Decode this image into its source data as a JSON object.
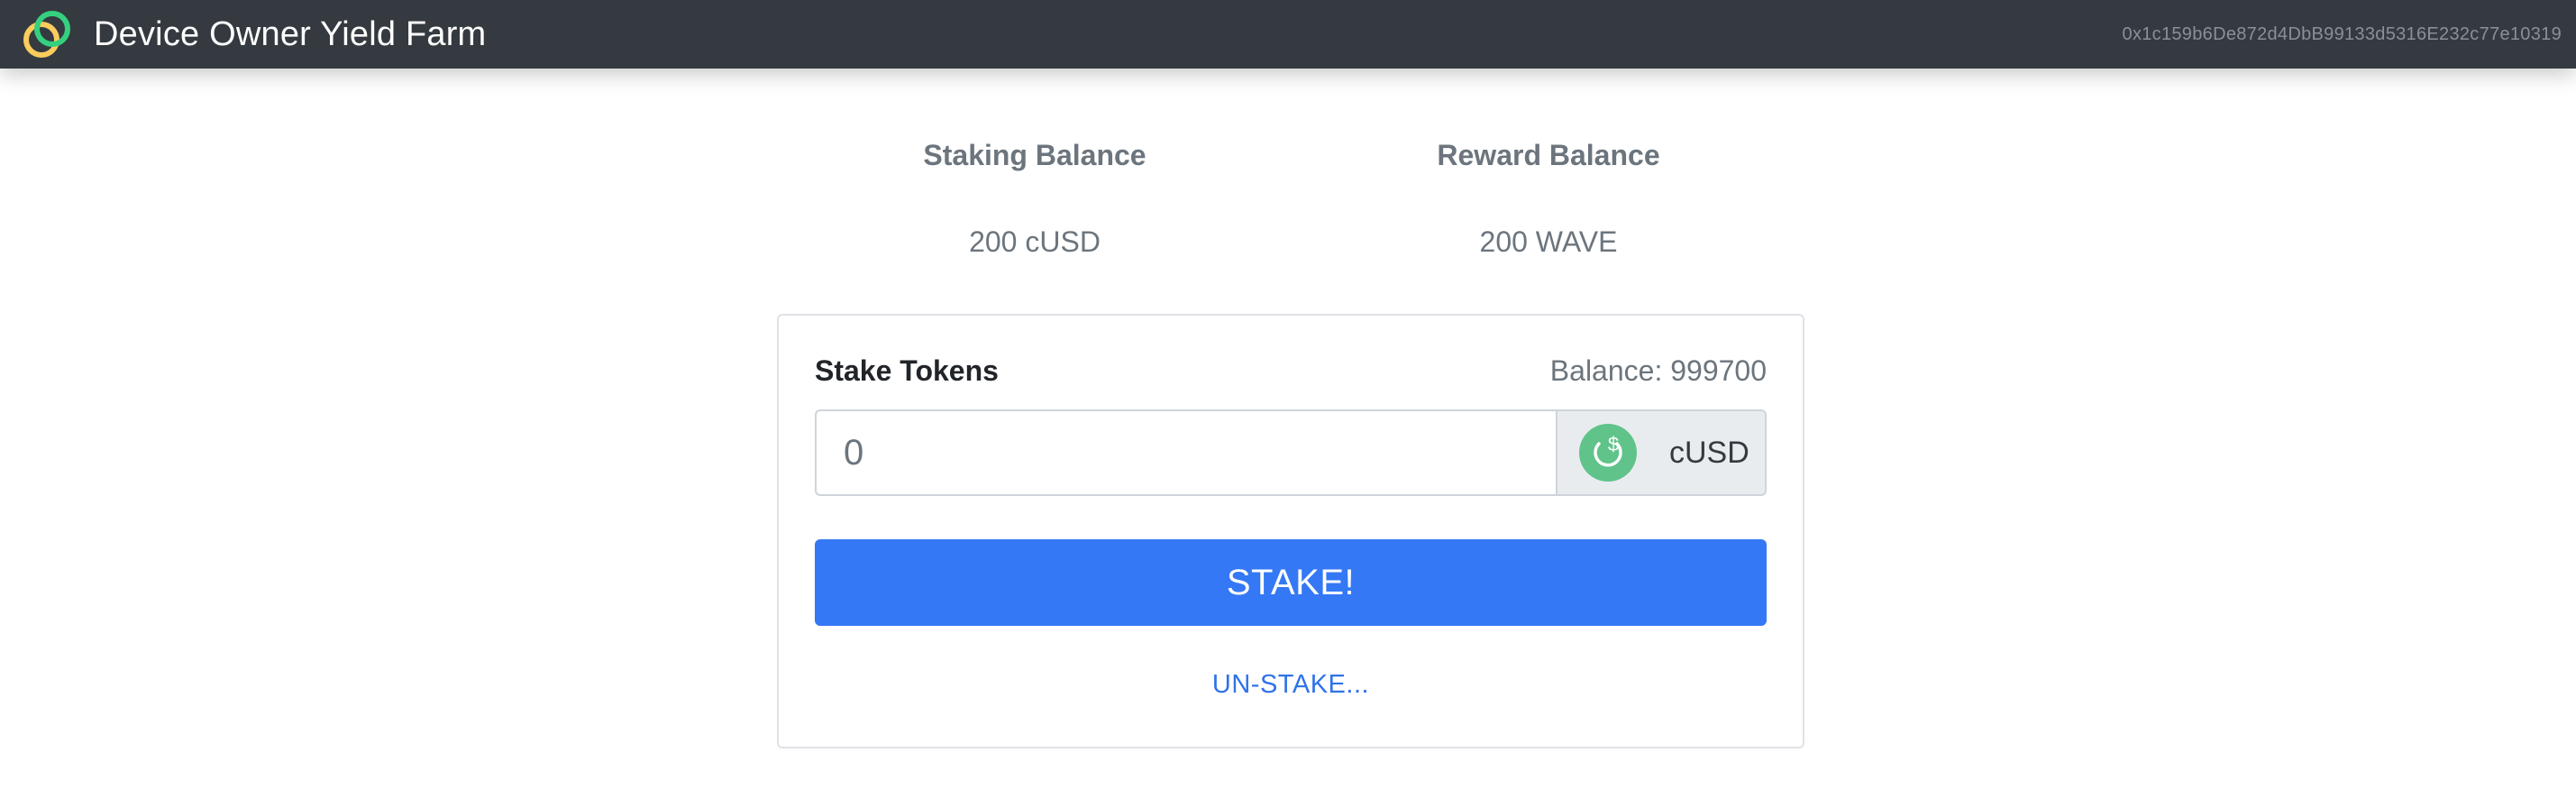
{
  "app": {
    "title": "Device Owner Yield Farm",
    "account": "0x1c159b6De872d4DbB99133d5316E232c77e10319"
  },
  "balances": {
    "staking_heading": "Staking Balance",
    "staking_value": "200 cUSD",
    "reward_heading": "Reward Balance",
    "reward_value": "200 WAVE"
  },
  "stake_form": {
    "label": "Stake Tokens",
    "balance_text": "Balance: 999700",
    "amount_placeholder": "0",
    "amount_value": "",
    "token_symbol": "cUSD",
    "token_icon": "dollar-coin-icon",
    "stake_button": "STAKE!",
    "unstake_link": "UN-STAKE..."
  },
  "colors": {
    "navbar": "#343a40",
    "primary": "#3578f5",
    "link": "#2f73e9",
    "token_green": "#5fc38a",
    "logo_green": "#35d07f",
    "logo_yellow": "#fbcc5c"
  }
}
